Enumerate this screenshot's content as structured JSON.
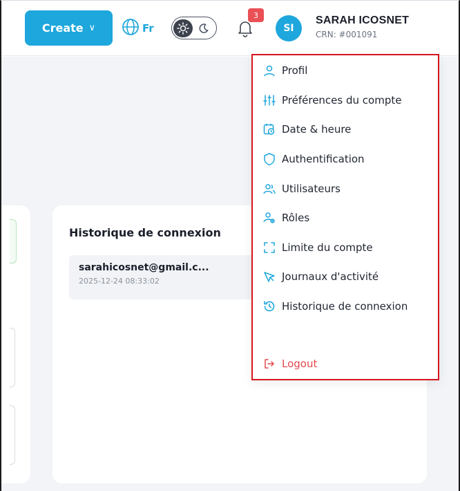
{
  "header": {
    "create_label": "Create",
    "create_chevron": "∨",
    "language_label": "Fr",
    "notification_count": "3",
    "avatar_initials": "SI",
    "user_name": "SARAH ICOSNET",
    "user_crn": "CRN: #001091"
  },
  "login_history": {
    "title": "Historique de connexion",
    "items": [
      {
        "email": "sarahicosnet@gmail.c...",
        "timestamp": "2025-12-24 08:33:02"
      }
    ]
  },
  "menu": {
    "items": [
      {
        "label": "Profil",
        "icon": "user-icon"
      },
      {
        "label": "Préférences du compte",
        "icon": "sliders-icon"
      },
      {
        "label": "Date & heure",
        "icon": "calendar-clock-icon"
      },
      {
        "label": "Authentification",
        "icon": "shield-icon"
      },
      {
        "label": "Utilisateurs",
        "icon": "users-icon"
      },
      {
        "label": "Rôles",
        "icon": "user-gear-icon"
      },
      {
        "label": "Limite du compte",
        "icon": "frame-corners-icon"
      },
      {
        "label": "Journaux d'activité",
        "icon": "cursor-icon"
      },
      {
        "label": "Historique de connexion",
        "icon": "history-icon"
      }
    ],
    "logout_label": "Logout"
  },
  "colors": {
    "accent": "#1ea7dc",
    "badge": "#ea5055",
    "logout": "#e5484d",
    "highlight_border": "#d6141e"
  }
}
